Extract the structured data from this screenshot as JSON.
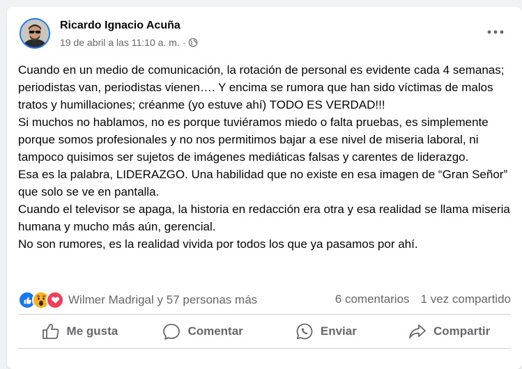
{
  "post": {
    "author": "Ricardo Ignacio Acuña",
    "date": "19 de abril a las 11:10 a. m.",
    "separator": "·",
    "audience_icon": "globe-icon",
    "paragraphs": [
      "Cuando en un medio de comunicación, la rotación de personal es evidente cada 4 semanas; periodistas van, periodistas vienen…. Y encima se rumora que han sido víctimas de malos tratos y humillaciones; créanme (yo estuve ahí) TODO ES VERDAD!!!",
      "Si muchos no hablamos, no es porque tuviéramos miedo o falta pruebas, es simplemente porque somos profesionales y no nos permitimos bajar a ese nivel de miseria laboral, ni tampoco quisimos ser sujetos de imágenes mediáticas falsas y carentes de liderazgo.",
      "Esa es la palabra, LIDERAZGO. Una habilidad que no existe en esa imagen de “Gran Señor” que solo se ve en pantalla.",
      "Cuando el televisor se apaga, la historia en redacción era otra y esa realidad se llama miseria humana y mucho más aún, gerencial.",
      "No son rumores, es la realidad vivida por todos los que ya pasamos por ahí."
    ]
  },
  "reactions": {
    "icons": [
      "like-icon",
      "wow-icon",
      "love-icon"
    ],
    "reactors": "Wilmer Madrigal y 57 personas más",
    "comments": "6 comentarios",
    "shares": "1 vez compartido"
  },
  "actions": {
    "like": "Me gusta",
    "comment": "Comentar",
    "send": "Enviar",
    "share": "Compartir"
  },
  "colors": {
    "accent": "#1877f2",
    "secondary_text": "#65676b",
    "love": "#f33e58",
    "wow": "#f7b125"
  }
}
